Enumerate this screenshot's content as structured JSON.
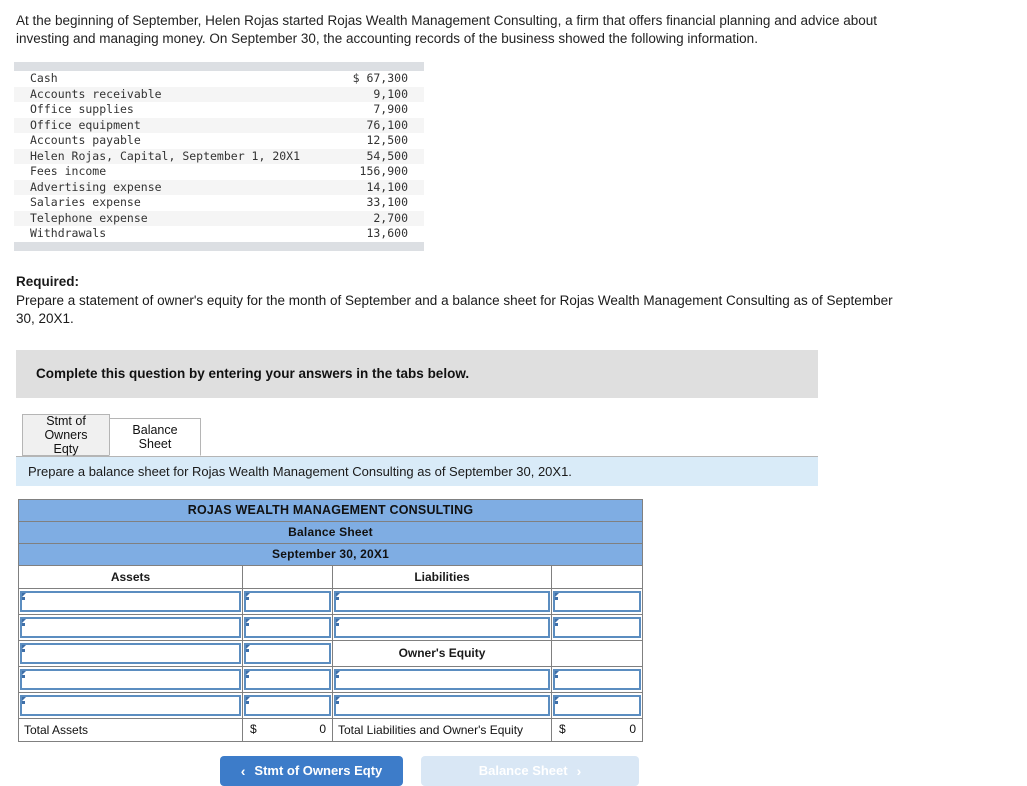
{
  "intro": {
    "paragraph": "At the beginning of September, Helen Rojas started Rojas Wealth Management Consulting, a firm that offers financial planning and advice about investing and managing money. On September 30, the accounting records of the business showed the following information."
  },
  "facts_table": {
    "rows": [
      {
        "label": "Cash",
        "amount": "$ 67,300"
      },
      {
        "label": "Accounts receivable",
        "amount": "9,100"
      },
      {
        "label": "Office supplies",
        "amount": "7,900"
      },
      {
        "label": "Office equipment",
        "amount": "76,100"
      },
      {
        "label": "Accounts payable",
        "amount": "12,500"
      },
      {
        "label": "Helen Rojas, Capital, September 1, 20X1",
        "amount": "54,500"
      },
      {
        "label": "Fees income",
        "amount": "156,900"
      },
      {
        "label": "Advertising expense",
        "amount": "14,100"
      },
      {
        "label": "Salaries expense",
        "amount": "33,100"
      },
      {
        "label": "Telephone expense",
        "amount": "2,700"
      },
      {
        "label": "Withdrawals",
        "amount": "13,600"
      }
    ]
  },
  "required": {
    "heading": "Required:",
    "text": "Prepare a statement of owner's equity for the month of September and a balance sheet for Rojas Wealth Management Consulting as of September 30, 20X1."
  },
  "callout": {
    "text": "Complete this question by entering your answers in the tabs below."
  },
  "tabs": {
    "items": [
      {
        "label": "Stmt of\nOwners Eqty",
        "active": false
      },
      {
        "label": "Balance Sheet",
        "active": true
      }
    ]
  },
  "instruction": {
    "text": "Prepare a balance sheet for Rojas Wealth Management Consulting as of September 30, 20X1."
  },
  "balance_sheet": {
    "title_line1": "ROJAS WEALTH MANAGEMENT CONSULTING",
    "title_line2": "Balance Sheet",
    "title_line3": "September 30, 20X1",
    "col_head_assets": "Assets",
    "col_head_liabilities": "Liabilities",
    "section_owners_equity": "Owner's Equity",
    "total_assets_label": "Total Assets",
    "total_assets_currency": "$",
    "total_assets_value": "0",
    "total_liab_equity_label": "Total Liabilities and Owner's Equity",
    "total_liab_equity_currency": "$",
    "total_liab_equity_value": "0",
    "header_color": "#7fade3",
    "input_border_color": "#5b8dc0"
  },
  "nav": {
    "prev_label": "Stmt of Owners Eqty",
    "prev_chevron": "‹",
    "next_label": "Balance Sheet",
    "next_chevron": "›",
    "primary_color": "#3d7cc9",
    "ghost_color": "#d9e7f5"
  }
}
